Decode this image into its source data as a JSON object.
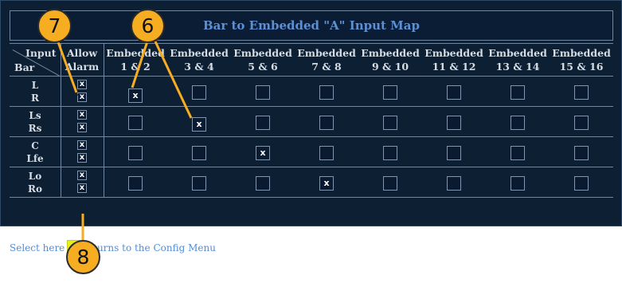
{
  "title": "Bar to Embedded \"A\" Input Map",
  "header": {
    "input_label": "Input",
    "bar_label": "Bar",
    "allow_label": "Allow",
    "alarm_label": "Alarm",
    "columns": [
      {
        "top": "Embedded",
        "bottom": "1 & 2"
      },
      {
        "top": "Embedded",
        "bottom": "3 & 4"
      },
      {
        "top": "Embedded",
        "bottom": "5 & 6"
      },
      {
        "top": "Embedded",
        "bottom": "7 & 8"
      },
      {
        "top": "Embedded",
        "bottom": "9 & 10"
      },
      {
        "top": "Embedded",
        "bottom": "11 & 12"
      },
      {
        "top": "Embedded",
        "bottom": "13 & 14"
      },
      {
        "top": "Embedded",
        "bottom": "15 & 16"
      }
    ]
  },
  "rows": [
    {
      "labels": [
        "L",
        "R"
      ],
      "alarm": [
        "x",
        "x"
      ],
      "mapped_column": 1,
      "mark": "x"
    },
    {
      "labels": [
        "Ls",
        "Rs"
      ],
      "alarm": [
        "x",
        "x"
      ],
      "mapped_column": 2,
      "mark": "x"
    },
    {
      "labels": [
        "C",
        "Lfe"
      ],
      "alarm": [
        "x",
        "x"
      ],
      "mapped_column": 3,
      "mark": "x"
    },
    {
      "labels": [
        "Lo",
        "Ro"
      ],
      "alarm": [
        "x",
        "x"
      ],
      "mapped_column": 4,
      "mark": "x"
    }
  ],
  "footer": {
    "text_before": "Select here",
    "text_after": "returns to the Config Menu"
  },
  "callouts": [
    "7",
    "6",
    "8"
  ],
  "colors": {
    "background": "#0d1f33",
    "title_text": "#5b8fd6",
    "grid_line": "#6f87a3",
    "footer_text": "#4f8fd8",
    "select_button": "#e8ee1a",
    "callout": "#f7ad22"
  }
}
